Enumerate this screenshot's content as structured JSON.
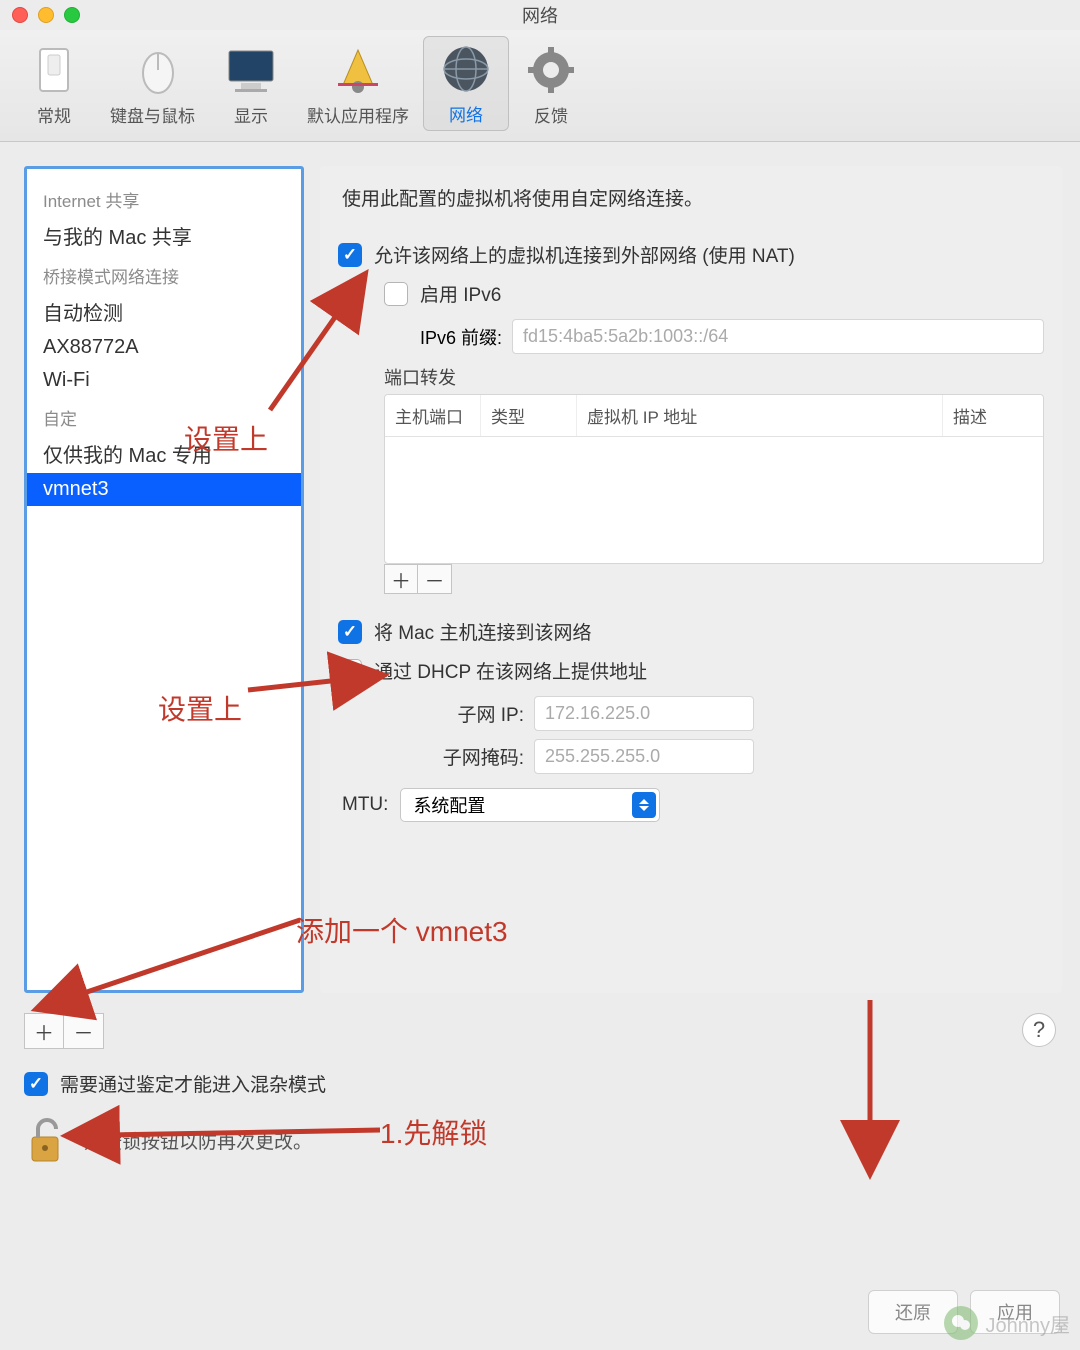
{
  "window_title": "网络",
  "toolbar": {
    "items": [
      {
        "label": "常规"
      },
      {
        "label": "键盘与鼠标"
      },
      {
        "label": "显示"
      },
      {
        "label": "默认应用程序"
      },
      {
        "label": "网络",
        "selected": true
      },
      {
        "label": "反馈"
      }
    ]
  },
  "sidebar": {
    "groups": [
      {
        "header": "Internet 共享",
        "items": [
          "与我的 Mac 共享"
        ]
      },
      {
        "header": "桥接模式网络连接",
        "items": [
          "自动检测",
          "AX88772A",
          "Wi-Fi"
        ]
      },
      {
        "header": "自定",
        "items": [
          "仅供我的 Mac 专用",
          "vmnet3"
        ]
      }
    ],
    "selected": "vmnet3"
  },
  "main": {
    "intro": "使用此配置的虚拟机将使用自定网络连接。",
    "nat_check": "允许该网络上的虚拟机连接到外部网络 (使用 NAT)",
    "ipv6_check": "启用 IPv6",
    "ipv6_prefix_label": "IPv6 前缀:",
    "ipv6_prefix_value": "fd15:4ba5:5a2b:1003::/64",
    "port_fwd_label": "端口转发",
    "columns": [
      "主机端口",
      "类型",
      "虚拟机 IP 地址",
      "描述"
    ],
    "connect_host_check": "将 Mac 主机连接到该网络",
    "dhcp_check": "通过 DHCP 在该网络上提供地址",
    "subnet_ip_label": "子网 IP:",
    "subnet_ip_value": "172.16.225.0",
    "subnet_mask_label": "子网掩码:",
    "subnet_mask_value": "255.255.255.0",
    "mtu_label": "MTU:",
    "mtu_value": "系统配置"
  },
  "bottom": {
    "promisc_check": "需要通过鉴定才能进入混杂模式",
    "lock_text": "点按锁按钮以防再次更改。",
    "restore_btn": "还原",
    "apply_btn": "应用"
  },
  "annotations": {
    "set1": "设置上",
    "set2": "设置上",
    "add_vmnet3": "添加一个 vmnet3",
    "unlock_first": "1.先解锁"
  },
  "watermark": "Johnny屋"
}
